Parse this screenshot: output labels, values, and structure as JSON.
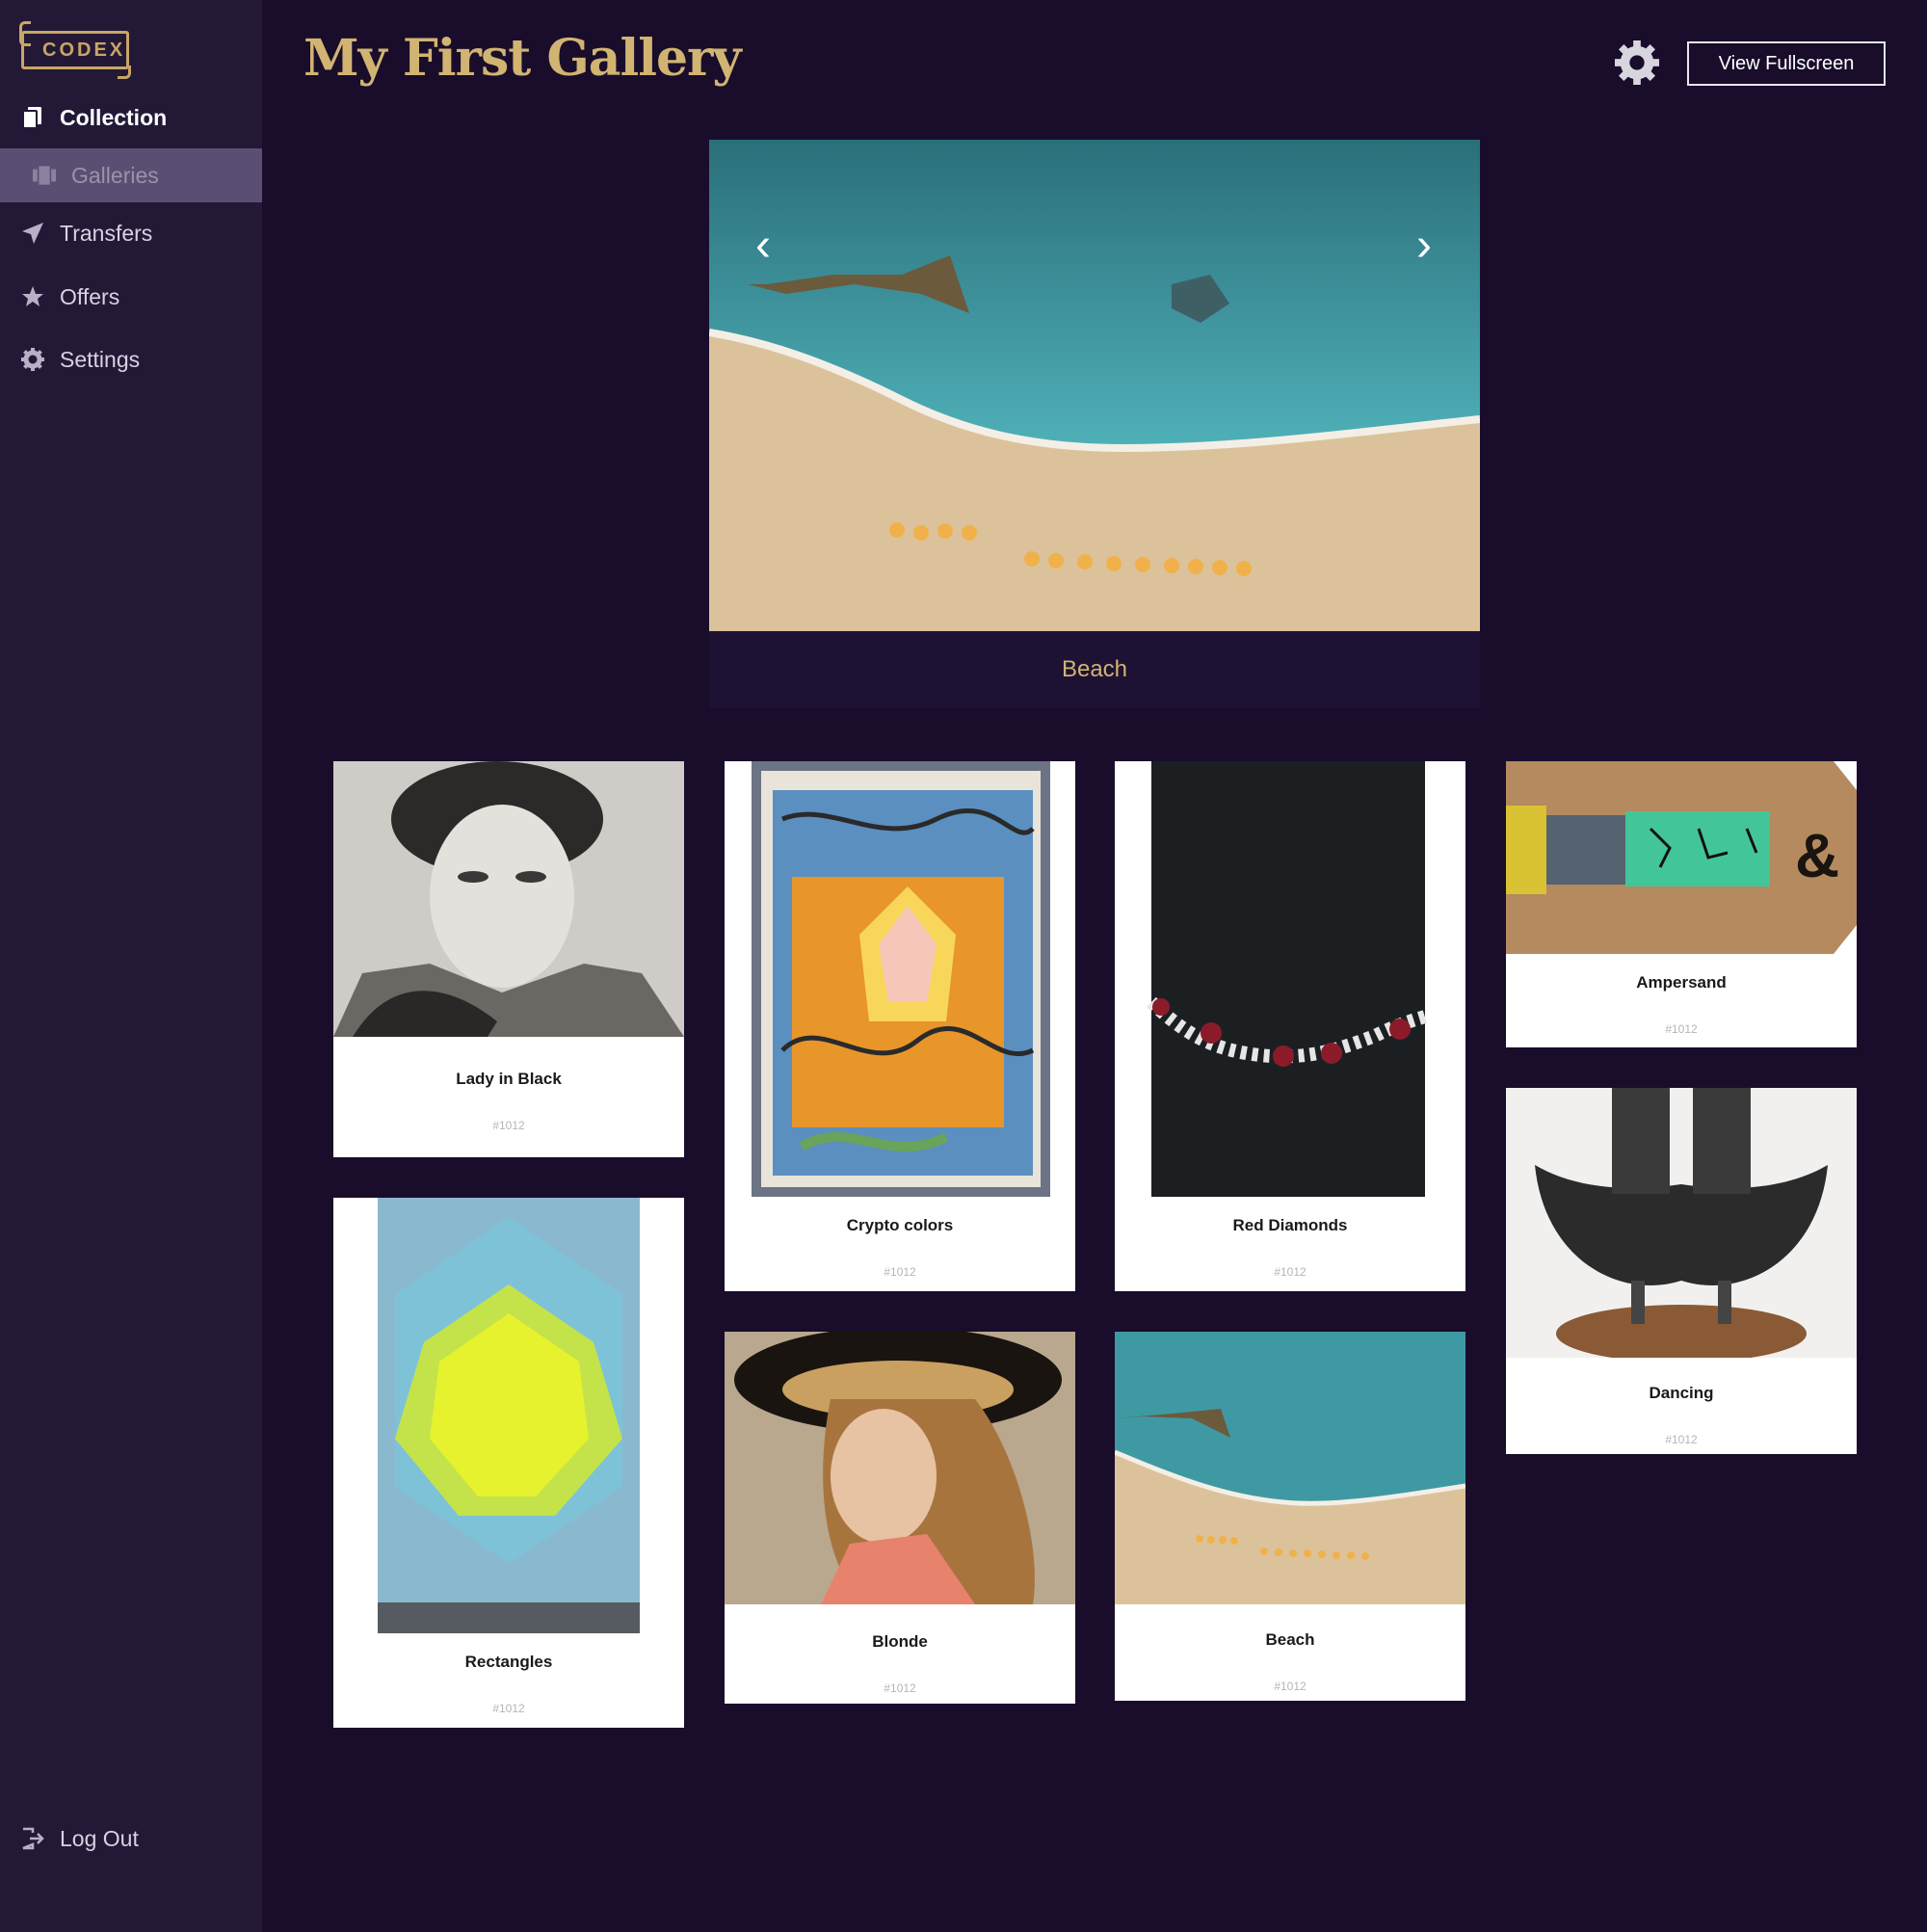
{
  "brand": {
    "logo_text": "CODEX"
  },
  "sidebar": {
    "items": [
      {
        "label": "Collection",
        "icon": "collection-icon"
      },
      {
        "label": "Galleries",
        "icon": "galleries-icon"
      },
      {
        "label": "Transfers",
        "icon": "send-icon"
      },
      {
        "label": "Offers",
        "icon": "star-icon"
      },
      {
        "label": "Settings",
        "icon": "gear-icon"
      }
    ],
    "logout": {
      "label": "Log Out",
      "icon": "logout-icon"
    }
  },
  "header": {
    "title": "My First Gallery",
    "settings_icon": "gear-icon",
    "fullscreen_label": "View Fullscreen"
  },
  "carousel": {
    "caption": "Beach",
    "prev_icon": "chevron-left-icon",
    "next_icon": "chevron-right-icon",
    "prev_glyph": "‹",
    "next_glyph": "›"
  },
  "cards": [
    {
      "name": "Lady in Black",
      "id": "#1012"
    },
    {
      "name": "Crypto colors",
      "id": "#1012"
    },
    {
      "name": "Red Diamonds",
      "id": "#1012"
    },
    {
      "name": "Ampersand",
      "id": "#1012"
    },
    {
      "name": "Rectangles",
      "id": "#1012"
    },
    {
      "name": "Blonde",
      "id": "#1012"
    },
    {
      "name": "Beach",
      "id": "#1012"
    },
    {
      "name": "Dancing",
      "id": "#1012"
    }
  ],
  "colors": {
    "background": "#190d2b",
    "sidebar": "#231937",
    "accent_gold": "#d1b472",
    "selected_item": "#5a4f72"
  }
}
